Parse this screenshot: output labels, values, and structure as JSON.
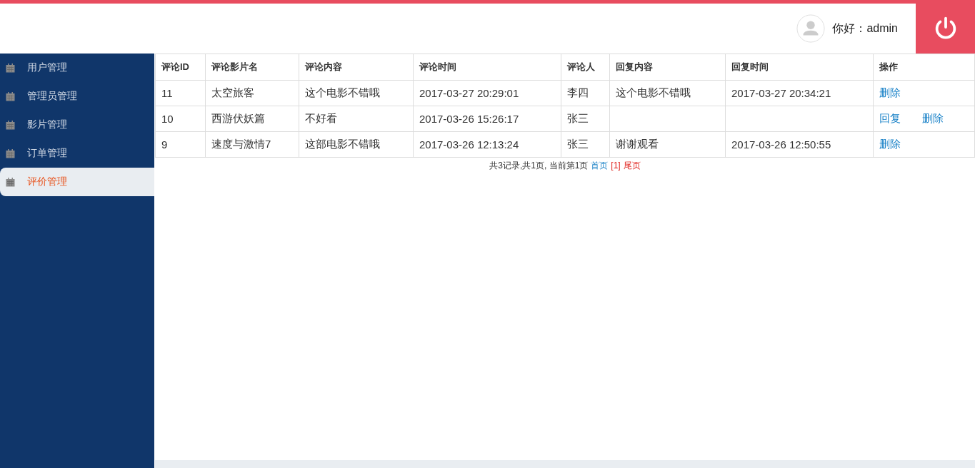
{
  "header": {
    "greeting": "你好：admin"
  },
  "sidebar": {
    "items": [
      {
        "label": "用户管理",
        "selected": false
      },
      {
        "label": "管理员管理",
        "selected": false
      },
      {
        "label": "影片管理",
        "selected": false
      },
      {
        "label": "订单管理",
        "selected": false
      },
      {
        "label": "评价管理",
        "selected": true
      }
    ]
  },
  "table": {
    "columns": [
      "评论ID",
      "评论影片名",
      "评论内容",
      "评论时间",
      "评论人",
      "回复内容",
      "回复时间",
      "操作"
    ],
    "rows": [
      {
        "cells": [
          "11",
          "太空旅客",
          "这个电影不错哦",
          "2017-03-27 20:29:01",
          "李四",
          "这个电影不错哦",
          "2017-03-27 20:34:21"
        ],
        "actions": [
          "删除"
        ]
      },
      {
        "cells": [
          "10",
          "西游伏妖篇",
          "不好看",
          "2017-03-26 15:26:17",
          "张三",
          "",
          ""
        ],
        "actions": [
          "回复",
          "删除"
        ]
      },
      {
        "cells": [
          "9",
          "速度与激情7",
          "这部电影不错哦",
          "2017-03-26 12:13:24",
          "张三",
          "谢谢观看",
          "2017-03-26 12:50:55"
        ],
        "actions": [
          "删除"
        ]
      }
    ]
  },
  "pagination": {
    "summary": "共3记录,共1页, 当前第1页",
    "first": "首页",
    "current": "[1]",
    "last": "尾页"
  }
}
